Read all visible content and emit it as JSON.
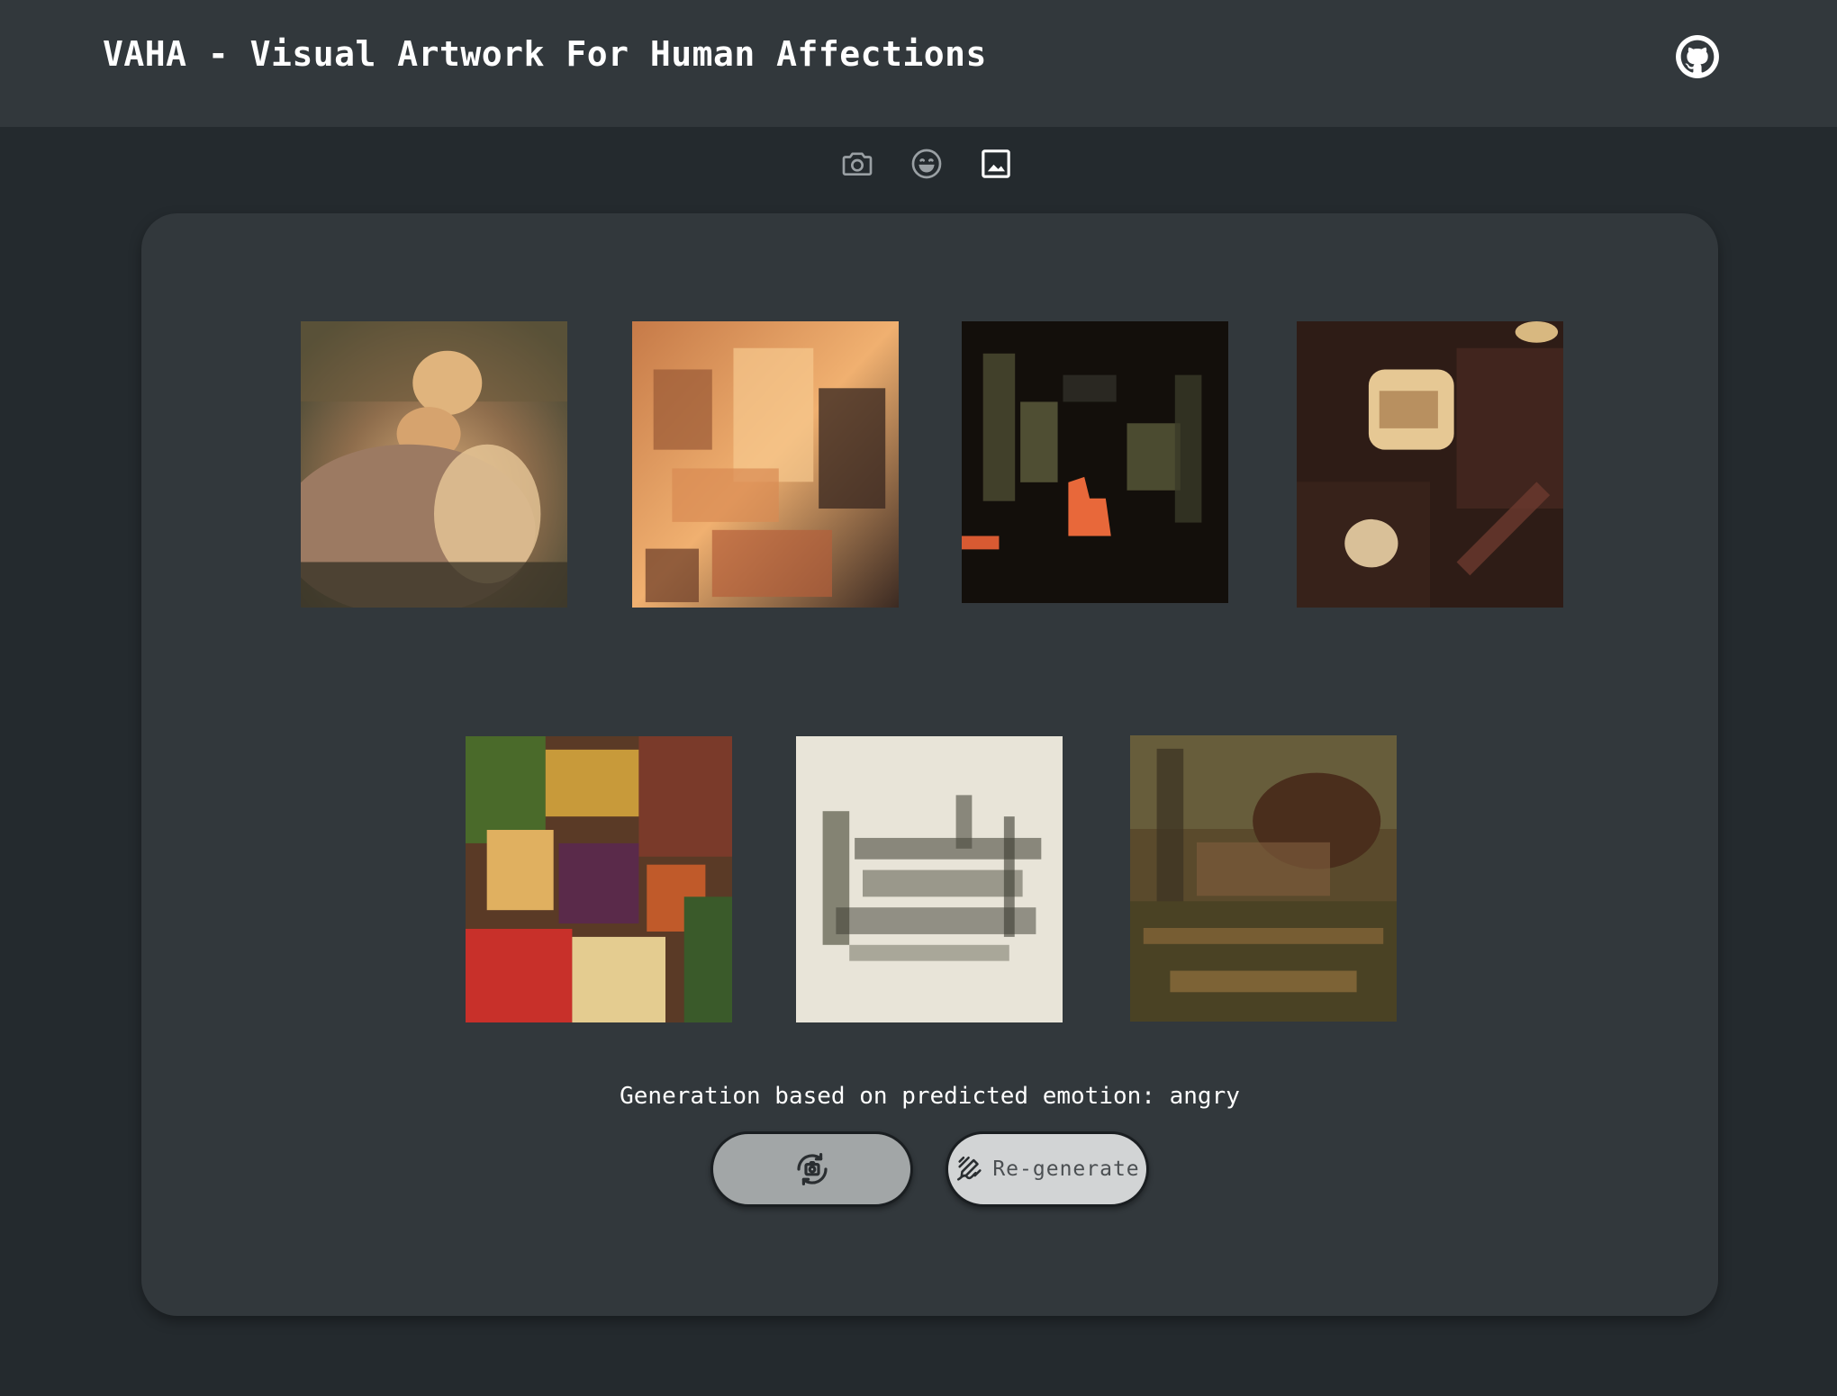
{
  "header": {
    "title": "VAHA - Visual Artwork For Human Affections",
    "github_icon": "github-icon"
  },
  "mode_tabs": [
    {
      "icon": "camera-icon",
      "active": false
    },
    {
      "icon": "smile-face-icon",
      "active": false
    },
    {
      "icon": "image-icon",
      "active": true
    }
  ],
  "gallery": {
    "artworks": [
      {
        "description_icon": "artwork-1",
        "palette": [
          "#b98a63",
          "#6f5a3f",
          "#d9ad7a",
          "#4c4a36"
        ]
      },
      {
        "description_icon": "artwork-2",
        "palette": [
          "#c5723f",
          "#f0b070",
          "#3b2a22",
          "#8a4e32"
        ]
      },
      {
        "description_icon": "artwork-3",
        "palette": [
          "#120e0a",
          "#5a5a3a",
          "#e86a3a",
          "#2a2520"
        ]
      },
      {
        "description_icon": "artwork-4",
        "palette": [
          "#3a2218",
          "#e0c490",
          "#6b3a2a",
          "#231613"
        ]
      },
      {
        "description_icon": "artwork-5",
        "palette": [
          "#c0892a",
          "#7a2a3a",
          "#3a5a2a",
          "#d84030"
        ]
      },
      {
        "description_icon": "artwork-6",
        "palette": [
          "#e6e2d6",
          "#6a6a5a",
          "#3a3a30",
          "#c9c3b0"
        ]
      },
      {
        "description_icon": "artwork-7",
        "palette": [
          "#5a4a2a",
          "#8a6a3a",
          "#3a3a22",
          "#a07a42"
        ]
      }
    ],
    "caption": "Generation based on predicted emotion: angry"
  },
  "actions": {
    "rotate_icon": "rotate-camera-icon",
    "regenerate_icon": "magic-draw-icon",
    "regenerate_label": "Re-generate"
  },
  "colors": {
    "background": "#242a2e",
    "surface": "#32383c",
    "text": "#ffffff",
    "icon_inactive": "#9aa0a4",
    "icon_active": "#ffffff"
  }
}
